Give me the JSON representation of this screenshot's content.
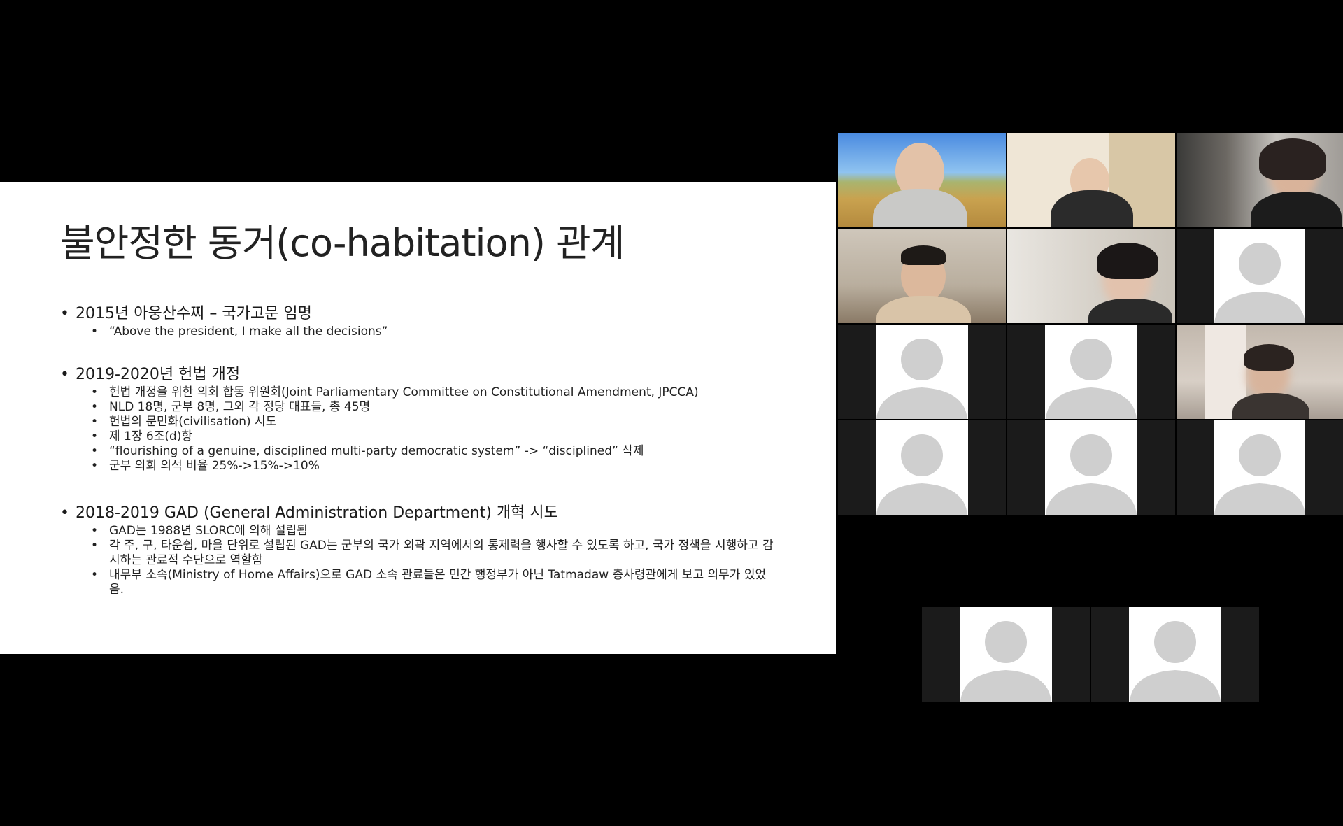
{
  "slide": {
    "title": "불안정한 동거(co-habitation) 관계",
    "bullet_glyph": "•",
    "sections": [
      {
        "heading": "2015년 아웅산수찌 – 국가고문 임명",
        "items": [
          "“Above the president, I make all the decisions”"
        ]
      },
      {
        "heading": "2019-2020년 헌법 개정",
        "items": [
          "헌법 개정을 위한 의회 합동 위원회(Joint Parliamentary Committee on Constitutional Amendment, JPCCA)",
          "NLD 18명, 군부 8명, 그외 각 정당 대표들, 총 45명",
          "헌법의 문민화(civilisation) 시도",
          "제 1장 6조(d)항",
          "“flourishing of a genuine, disciplined multi-party democratic system” -> “disciplined” 삭제",
          "군부 의회 의석 비율 25%->15%->10%"
        ]
      },
      {
        "heading": "2018-2019 GAD (General Administration Department) 개혁 시도",
        "items": [
          "GAD는 1988년 SLORC에 의해 설립됨",
          "각 주, 구, 타운쉽, 마을 단위로 설립된 GAD는 군부의 국가 외곽 지역에서의 통제력을 행사할 수 있도록 하고, 국가 정책을 시행하고 감시하는 관료적 수단으로 역할함",
          "내무부 소속(Ministry of Home Affairs)으로 GAD 소속 관료들은 민간 행정부가 아닌 Tatmadaw 총사령관에게 보고 의무가 있었음."
        ]
      }
    ]
  },
  "gallery": {
    "colors": {
      "avatar_fill": "#cfcfcf",
      "tile_background": "#1b1b1b",
      "avatar_card": "#ffffff"
    },
    "tiles": [
      {
        "kind": "video",
        "icon": "participant-video"
      },
      {
        "kind": "video",
        "icon": "participant-video"
      },
      {
        "kind": "video",
        "icon": "participant-video"
      },
      {
        "kind": "video",
        "icon": "participant-video"
      },
      {
        "kind": "video",
        "icon": "participant-video"
      },
      {
        "kind": "avatar",
        "icon": "user-silhouette-icon"
      },
      {
        "kind": "avatar",
        "icon": "user-silhouette-icon"
      },
      {
        "kind": "avatar",
        "icon": "user-silhouette-icon"
      },
      {
        "kind": "video",
        "icon": "participant-video"
      },
      {
        "kind": "avatar",
        "icon": "user-silhouette-icon"
      },
      {
        "kind": "avatar",
        "icon": "user-silhouette-icon"
      },
      {
        "kind": "avatar",
        "icon": "user-silhouette-icon"
      },
      {
        "kind": "avatar",
        "icon": "user-silhouette-icon"
      },
      {
        "kind": "avatar",
        "icon": "user-silhouette-icon"
      }
    ]
  }
}
